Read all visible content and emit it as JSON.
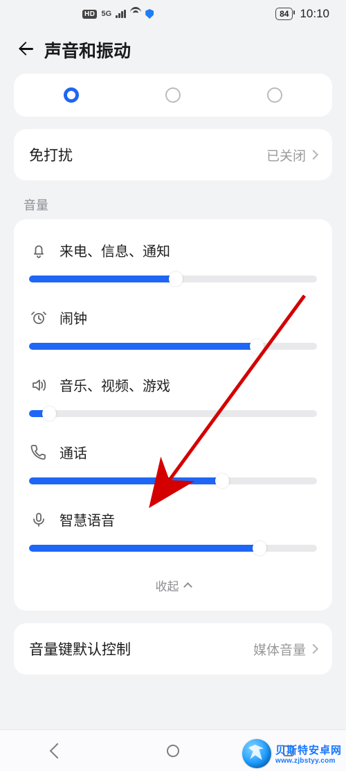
{
  "status": {
    "hd": "HD",
    "net": "5G",
    "battery": "84",
    "time": "10:10"
  },
  "header": {
    "title": "声音和振动"
  },
  "radio_selected_index": 0,
  "dnd": {
    "label": "免打扰",
    "value": "已关闭"
  },
  "section_volume_label": "音量",
  "volumes": {
    "ringtone": {
      "label": "来电、信息、通知",
      "percent": 51
    },
    "alarm": {
      "label": "闹钟",
      "percent": 79
    },
    "media": {
      "label": "音乐、视频、游戏",
      "percent": 7
    },
    "call": {
      "label": "通话",
      "percent": 67
    },
    "voice": {
      "label": "智慧语音",
      "percent": 80
    }
  },
  "collapse_label": "收起",
  "vol_key": {
    "label": "音量键默认控制",
    "value": "媒体音量"
  },
  "watermark": {
    "cn": "贝斯特安卓网",
    "en": "www.zjbstyy.com"
  },
  "accent": "#1e66f5"
}
